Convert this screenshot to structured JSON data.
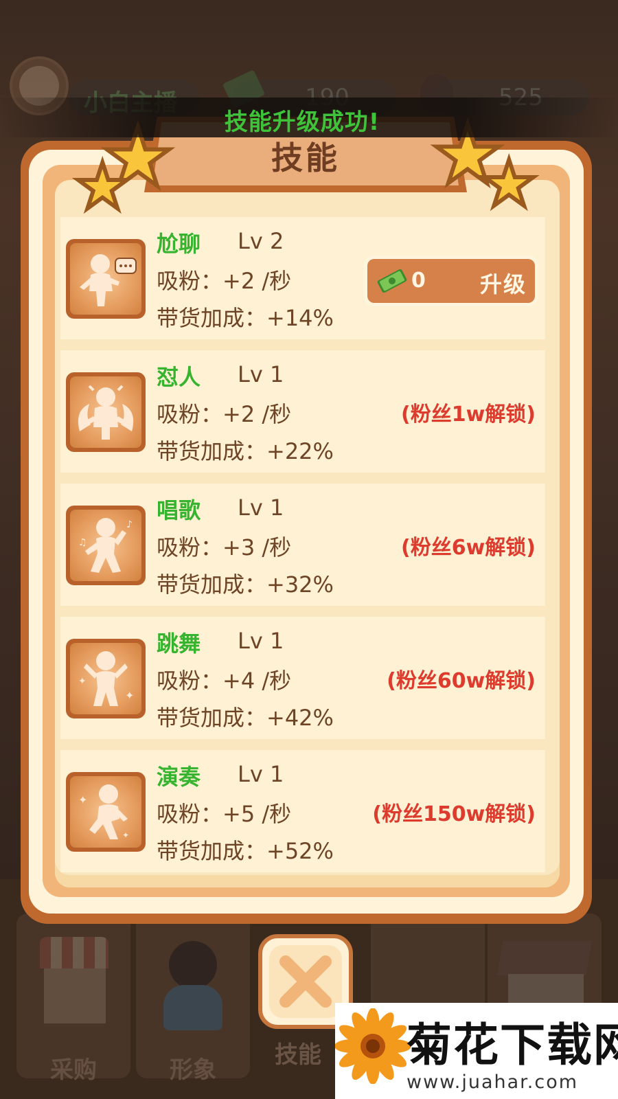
{
  "header": {
    "player_name": "小白主播",
    "money": "190",
    "fans": "525"
  },
  "toast": "技能升级成功!",
  "panel": {
    "title": "技能"
  },
  "skills": [
    {
      "name": "尬聊",
      "level": "Lv 2",
      "fans_rate": "吸粉：+2 /秒",
      "sales_bonus": "带货加成：+14%",
      "upgrade_cost": "0",
      "upgrade_label": "升级",
      "unlocked": true,
      "icon": "chat-pose-icon"
    },
    {
      "name": "怼人",
      "level": "Lv 1",
      "fans_rate": "吸粉：+2 /秒",
      "sales_bonus": "带货加成：+22%",
      "lock_text": "(粉丝1w解锁)",
      "unlocked": false,
      "icon": "angry-pose-icon"
    },
    {
      "name": "唱歌",
      "level": "Lv 1",
      "fans_rate": "吸粉：+3 /秒",
      "sales_bonus": "带货加成：+32%",
      "lock_text": "(粉丝6w解锁)",
      "unlocked": false,
      "icon": "singing-pose-icon"
    },
    {
      "name": "跳舞",
      "level": "Lv 1",
      "fans_rate": "吸粉：+4 /秒",
      "sales_bonus": "带货加成：+42%",
      "lock_text": "(粉丝60w解锁)",
      "unlocked": false,
      "icon": "dancing-pose-icon"
    },
    {
      "name": "演奏",
      "level": "Lv 1",
      "fans_rate": "吸粉：+5 /秒",
      "sales_bonus": "带货加成：+52%",
      "lock_text": "(粉丝150w解锁)",
      "unlocked": false,
      "icon": "performing-pose-icon"
    }
  ],
  "bottom_nav": {
    "purchase": "采购",
    "image": "形象",
    "skill": "技能"
  },
  "watermark": {
    "title": "菊花下载网",
    "url": "www.juahar.com"
  },
  "colors": {
    "skill_name": "#36b42f",
    "lock_text": "#dc3b2e",
    "panel_border": "#c0692f",
    "toast": "#3fc33a"
  }
}
